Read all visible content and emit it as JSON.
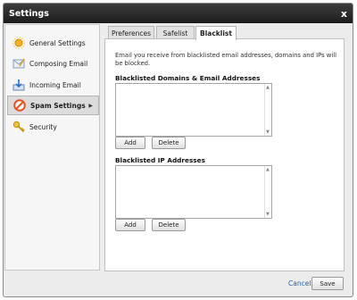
{
  "window": {
    "title": "Settings",
    "close_label": "x"
  },
  "sidebar": {
    "items": [
      {
        "label": "General Settings",
        "icon": "sun-icon"
      },
      {
        "label": "Composing Email",
        "icon": "compose-icon"
      },
      {
        "label": "Incoming Email",
        "icon": "inbox-download-icon"
      },
      {
        "label": "Spam Settings",
        "icon": "no-entry-icon",
        "active": true
      },
      {
        "label": "Security",
        "icon": "key-icon"
      }
    ]
  },
  "tabs": [
    {
      "label": "Preferences"
    },
    {
      "label": "Safelist"
    },
    {
      "label": "Blacklist",
      "active": true
    }
  ],
  "blacklist": {
    "description": "Email you receive from blacklisted email addresses, domains and IPs will be blocked.",
    "domains_title": "Blacklisted Domains & Email Addresses",
    "ips_title": "Blacklisted IP Addresses",
    "add_label": "Add",
    "delete_label": "Delete"
  },
  "footer": {
    "cancel_label": "Cancel",
    "save_label": "Save"
  },
  "colors": {
    "titlebar": "#2a2a2a",
    "link": "#2a5db0",
    "active_item": "#dcdcdc"
  }
}
